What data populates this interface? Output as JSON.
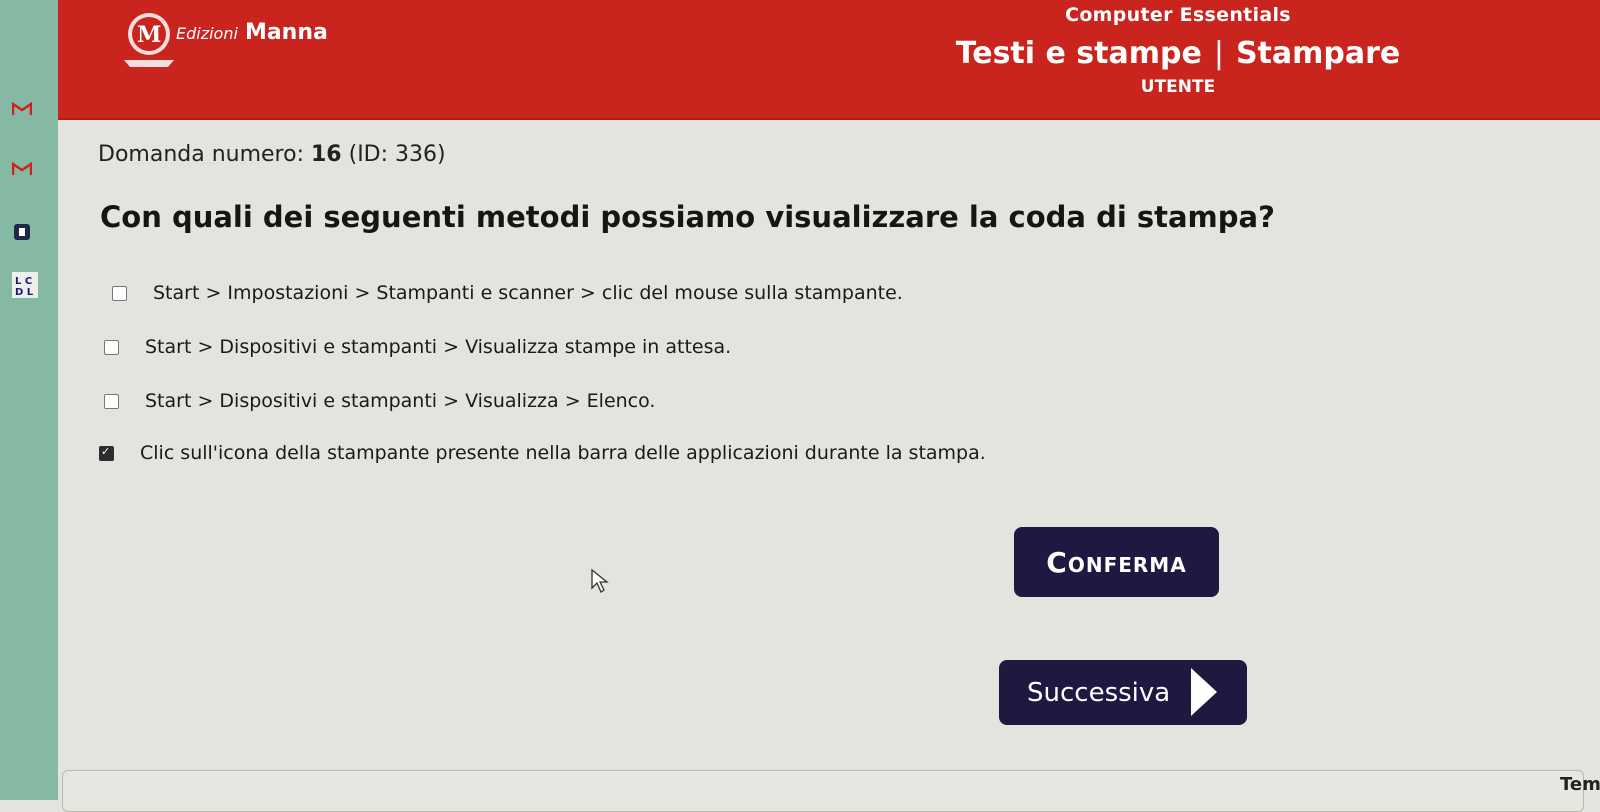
{
  "header": {
    "brand_italic": "Edizioni",
    "brand_name": "Manna",
    "logo_letter": "M",
    "course": "Computer Essentials",
    "module_left": "Testi e stampe",
    "module_sep": "|",
    "module_right": "Stampare",
    "role": "UTENTE"
  },
  "question": {
    "number_label": "Domanda numero:",
    "number": "16",
    "id": "(ID: 336)",
    "text": "Con quali dei seguenti metodi possiamo visualizzare la coda di stampa?"
  },
  "answers": [
    {
      "text": "Start > Impostazioni > Stampanti e scanner > clic del mouse sulla stampante.",
      "checked": false
    },
    {
      "text": "Start > Dispositivi e stampanti > Visualizza stampe in attesa.",
      "checked": false
    },
    {
      "text": "Start > Dispositivi e stampanti > Visualizza > Elenco.",
      "checked": false
    },
    {
      "text": "Clic sull'icona della stampante presente nella barra delle applicazioni durante la stampa.",
      "checked": true
    }
  ],
  "buttons": {
    "confirm": "Conferma",
    "next": "Successiva"
  },
  "footer": {
    "partial_text": "Tem"
  },
  "colors": {
    "header_red": "#c9241d",
    "button_navy": "#1e1940",
    "background": "#e4e3dd"
  }
}
